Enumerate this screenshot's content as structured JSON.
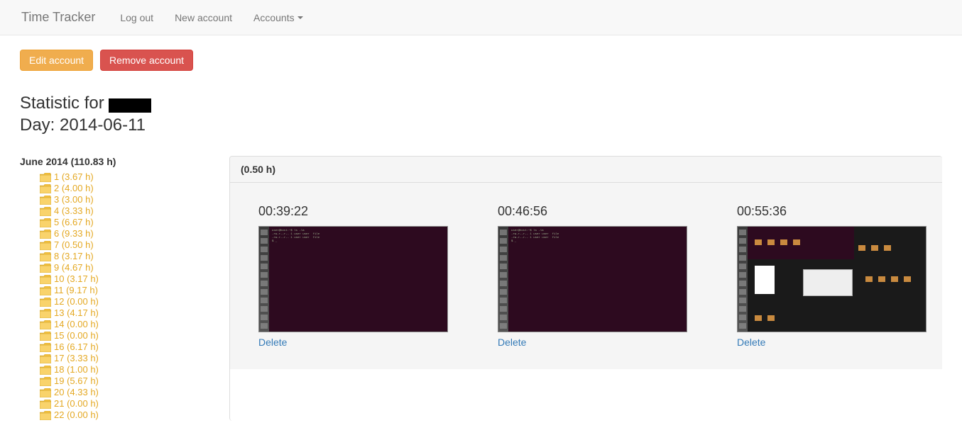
{
  "nav": {
    "brand": "Time Tracker",
    "links": [
      "Log out",
      "New account"
    ],
    "dropdown": "Accounts"
  },
  "buttons": {
    "edit": "Edit account",
    "remove": "Remove account"
  },
  "heading": {
    "prefix": "Statistic for ",
    "day_line": "Day: 2014-06-11"
  },
  "month_label": "June 2014 (110.83 h)",
  "days": [
    {
      "label": "1 (3.67 h)"
    },
    {
      "label": "2 (4.00 h)"
    },
    {
      "label": "3 (3.00 h)"
    },
    {
      "label": "4 (3.33 h)"
    },
    {
      "label": "5 (6.67 h)"
    },
    {
      "label": "6 (9.33 h)"
    },
    {
      "label": "7 (0.50 h)"
    },
    {
      "label": "8 (3.17 h)"
    },
    {
      "label": "9 (4.67 h)"
    },
    {
      "label": "10 (3.17 h)"
    },
    {
      "label": "11 (9.17 h)"
    },
    {
      "label": "12 (0.00 h)"
    },
    {
      "label": "13 (4.17 h)"
    },
    {
      "label": "14 (0.00 h)"
    },
    {
      "label": "15 (0.00 h)"
    },
    {
      "label": "16 (6.17 h)"
    },
    {
      "label": "17 (3.33 h)"
    },
    {
      "label": "18 (1.00 h)"
    },
    {
      "label": "19 (5.67 h)"
    },
    {
      "label": "20 (4.33 h)"
    },
    {
      "label": "21 (0.00 h)"
    },
    {
      "label": "22 (0.00 h)"
    }
  ],
  "panel": {
    "header": "(0.50 h)",
    "shots": [
      {
        "time": "00:39:22",
        "delete": "Delete",
        "kind": "terminal"
      },
      {
        "time": "00:46:56",
        "delete": "Delete",
        "kind": "terminal"
      },
      {
        "time": "00:55:36",
        "delete": "Delete",
        "kind": "desktop"
      }
    ]
  }
}
